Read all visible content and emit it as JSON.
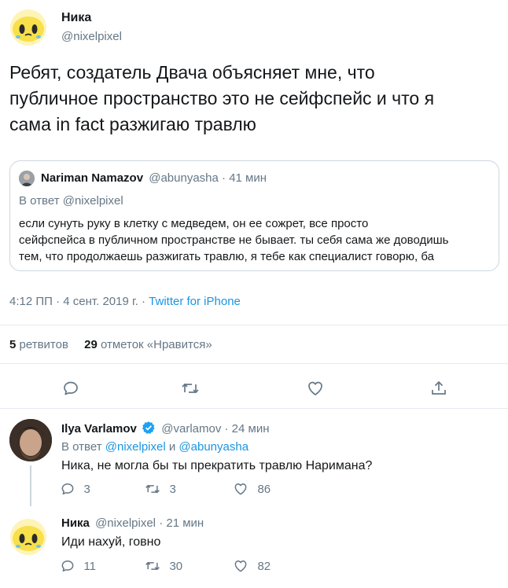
{
  "main_tweet": {
    "author_name": "Ника",
    "author_handle": "@nixelpixel",
    "text_lines": [
      "Ребят, создатель Двача объясняет мне, что",
      "публичное пространство это не сейфспейс и что я",
      "сама in fact разжигаю травлю"
    ],
    "time": "4:12 ПП",
    "date": "4 сент. 2019 г.",
    "source": "Twitter for iPhone",
    "retweets_count": "5",
    "retweets_label": "ретвитов",
    "likes_count": "29",
    "likes_label": "отметок «Нравится»"
  },
  "quoted_tweet": {
    "author_name": "Nariman Namazov",
    "author_handle": "@abunyasha",
    "time": "41 мин",
    "reply_to": "В ответ @nixelpixel",
    "text_lines": [
      "если сунуть руку в клетку с медведем, он ее сожрет, все просто",
      "сейфспейса в публичном пространстве не бывает. ты себя сама же доводишь",
      "тем, что продолжаешь разжигать травлю, я тебе как специалист говорю, ба"
    ]
  },
  "replies": [
    {
      "author_name": "Ilya Varlamov",
      "verified": true,
      "author_handle": "@varlamov",
      "time": "24 мин",
      "reply_prefix": "В ответ",
      "reply_user1": "@nixelpixel",
      "reply_and": "и",
      "reply_user2": "@abunyasha",
      "text": "Ника, не могла бы ты прекратить травлю Наримана?",
      "replies": "3",
      "retweets": "3",
      "likes": "86"
    },
    {
      "author_name": "Ника",
      "author_handle": "@nixelpixel",
      "time": "21 мин",
      "text": "Иди нахуй, говно",
      "replies": "11",
      "retweets": "30",
      "likes": "82"
    }
  ],
  "colors": {
    "text": "#14171a",
    "muted": "#657786",
    "link": "#1b95e0",
    "divider": "#e6ecf0",
    "verified": "#1da1f2"
  }
}
